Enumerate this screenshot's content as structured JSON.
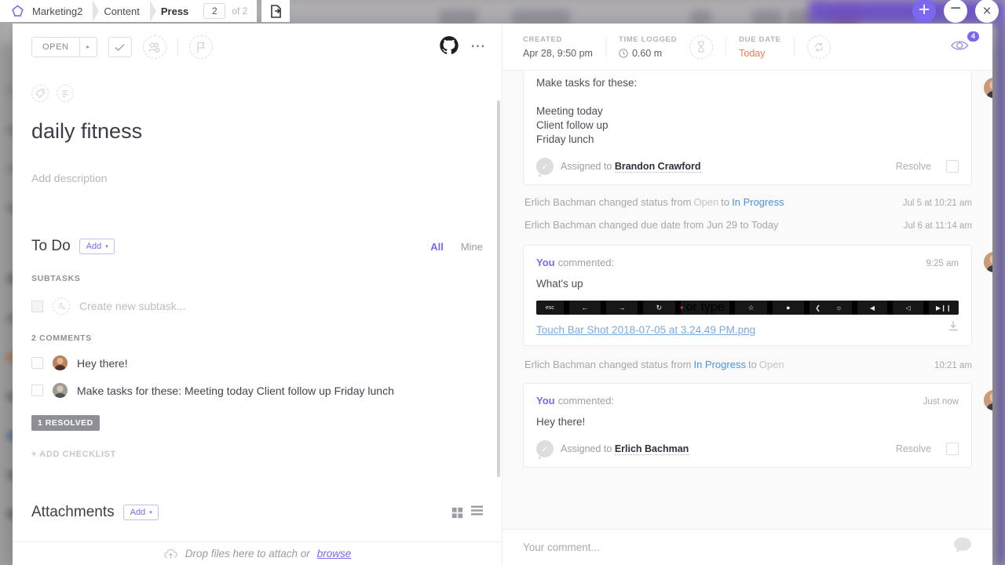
{
  "breadcrumb": {
    "logo_icon": "clickup-logo-icon",
    "space": "Marketing2",
    "folder": "Content",
    "list": "Press",
    "page_current": "2",
    "page_of": "of 2",
    "export_icon": "export-task-icon"
  },
  "window_controls": {
    "add_label": "+",
    "minimize_label": "−",
    "close_label": "×",
    "accent": "#7b68ee"
  },
  "task": {
    "status_label": "OPEN",
    "status_caret": "▸",
    "complete_icon": "checkmark-icon",
    "assignee_icon": "add-assignee-icon",
    "flag_icon": "priority-flag-icon",
    "github_icon": "github-icon",
    "more_icon": "more-options-icon",
    "tag_icon": "tag-icon",
    "list_icon": "task-type-icon",
    "title": "daily fitness",
    "description_placeholder": "Add description"
  },
  "todo": {
    "title": "To Do",
    "add_label": "Add",
    "add_caret": "▾",
    "tab_all": "All",
    "tab_mine": "Mine",
    "subtasks_label": "SUBTASKS",
    "new_subtask_placeholder": "Create new subtask...",
    "new_subtask_avatar_icon": "add-assignee-icon",
    "comments_label": "2 COMMENTS",
    "items": [
      {
        "text": "Hey there!",
        "avatar": "avatar-female"
      },
      {
        "text": "Make tasks for these: Meeting today Client follow up Friday lunch",
        "avatar": "avatar-male"
      }
    ],
    "resolved_badge": "1 RESOLVED",
    "add_checklist": "+ ADD CHECKLIST"
  },
  "attachments": {
    "title": "Attachments",
    "add_label": "Add",
    "add_caret": "▾",
    "grid_view_icon": "grid-view-icon",
    "list_view_icon": "list-view-icon",
    "drop_text": "Drop files here to attach or",
    "browse_label": "browse",
    "upload_icon": "upload-cloud-icon"
  },
  "meta": {
    "created_label": "CREATED",
    "created_value": "Apr 28, 9:50 pm",
    "time_logged_label": "TIME LOGGED",
    "time_logged_value": "0.60 m",
    "time_icon": "clock-icon",
    "timer_icon": "hourglass-icon",
    "due_label": "DUE DATE",
    "due_value": "Today",
    "due_color": "#f07a54",
    "recurring_icon": "recurring-icon",
    "watchers_icon": "eye-icon",
    "watchers_count": "4"
  },
  "activity": [
    {
      "kind": "comment",
      "body": "Make tasks for these:\n\nMeeting today\nClient follow up\nFriday lunch",
      "assigned_prefix": "Assigned to",
      "assigned_name": "Brandon Crawford",
      "resolve_label": "Resolve"
    },
    {
      "kind": "log",
      "actor": "Erlich Bachman",
      "action": "changed status from",
      "from": "Open",
      "to_word": "to",
      "to": "In Progress",
      "time": "Jul 5 at 10:21 am"
    },
    {
      "kind": "log",
      "actor": "Erlich Bachman",
      "action": "changed due date from Jun 29 to Today",
      "time": "Jul 6 at 11:14 am"
    },
    {
      "kind": "comment",
      "who": "You",
      "commented": "commented:",
      "time": "9:25 am",
      "body": "What's up",
      "attachment_name": "Touch Bar Shot 2018-07-05 at 3.24.49 PM.png",
      "download_icon": "download-icon",
      "touchbar": {
        "esc": "esc",
        "back": "←",
        "forward": "→",
        "reload": "↻",
        "search_label": "Search or type URL",
        "google_icon": "google-icon",
        "star": "☆",
        "record": "●",
        "prev": "❮",
        "brightness": "☼",
        "volume": "◀",
        "mute": "◁",
        "play": "▶❙❙"
      }
    },
    {
      "kind": "log",
      "actor": "Erlich Bachman",
      "action": "changed status from",
      "from": "In Progress",
      "to_word": "to",
      "to": "Open",
      "time": "10:21 am",
      "from_is_progress": true
    },
    {
      "kind": "comment",
      "who": "You",
      "commented": "commented:",
      "time": "Just now",
      "body": "Hey there!",
      "assigned_prefix": "Assigned to",
      "assigned_name": "Erlich Bachman",
      "resolve_label": "Resolve"
    }
  ],
  "comment_bar": {
    "placeholder": "Your comment...",
    "bubble_icon": "comment-bubble-icon"
  }
}
